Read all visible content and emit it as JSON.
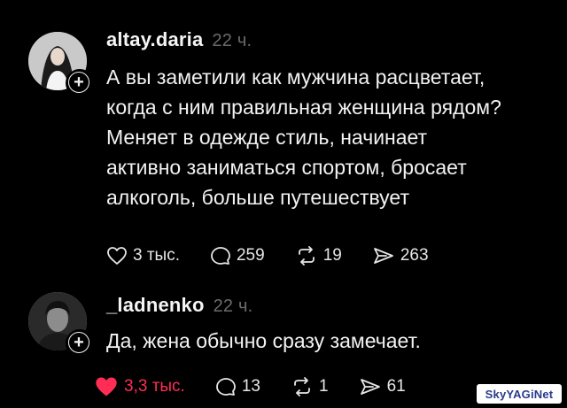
{
  "posts": [
    {
      "username": "altay.daria",
      "time": "22 ч.",
      "text": "А вы заметили как мужчина расцветает,\nкогда с ним правильная женщина рядом?\nМеняет в одежде стиль, начинает\nактивно заниматься спортом, бросает\nалкоголь, больше путешествует",
      "likes": "3 тыс.",
      "comments": "259",
      "reposts": "19",
      "shares": "263",
      "liked": false
    },
    {
      "username": "_ladnenko",
      "time": "22 ч.",
      "text": "Да, жена обычно сразу замечает.",
      "likes": "3,3 тыс.",
      "comments": "13",
      "reposts": "1",
      "shares": "61",
      "liked": true
    }
  ],
  "follow_symbol": "+",
  "watermark": "SkyYAGiNet",
  "colors": {
    "background": "#000000",
    "text": "#f2f2f2",
    "muted": "#6b6b6b",
    "like_active": "#ff2d55"
  },
  "icons": [
    "heart-icon",
    "comment-icon",
    "repost-icon",
    "share-icon",
    "plus-icon"
  ]
}
